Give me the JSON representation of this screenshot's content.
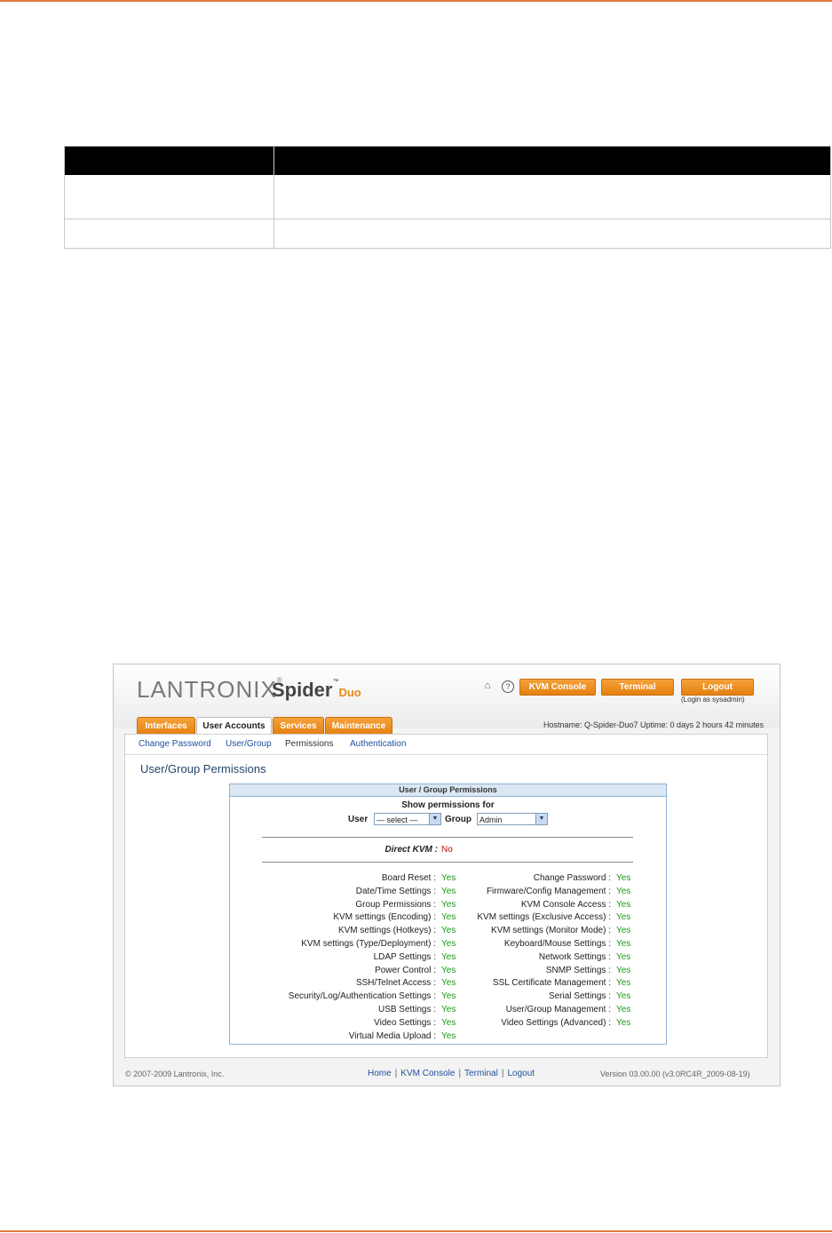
{
  "shot": {
    "brand": "LANTRONIX",
    "product": "Spider",
    "product_suffix": "Duo",
    "buttons": [
      "KVM Console",
      "Terminal",
      "Logout"
    ],
    "login_as": "(Login as sysadmin)",
    "tabs": [
      "Interfaces",
      "User Accounts",
      "Services",
      "Maintenance"
    ],
    "hostinfo": "Hostname: Q-Spider-Duo7    Uptime: 0 days 2 hours 42 minutes",
    "subnav": [
      "Change Password",
      "User/Group",
      "Permissions",
      "Authentication"
    ],
    "page_title": "User/Group Permissions",
    "panel_title": "User / Group Permissions",
    "show_for": "Show permissions for",
    "user_label": "User",
    "user_value": "— select —",
    "group_label": "Group",
    "group_value": "Admin",
    "direct_kvm_label": "Direct KVM :",
    "direct_kvm_value": "No",
    "left_perms": [
      {
        "label": "Board Reset :",
        "value": "Yes"
      },
      {
        "label": "Date/Time Settings :",
        "value": "Yes"
      },
      {
        "label": "Group Permissions :",
        "value": "Yes"
      },
      {
        "label": "KVM settings (Encoding) :",
        "value": "Yes"
      },
      {
        "label": "KVM settings (Hotkeys) :",
        "value": "Yes"
      },
      {
        "label": "KVM settings (Type/Deployment) :",
        "value": "Yes"
      },
      {
        "label": "LDAP Settings :",
        "value": "Yes"
      },
      {
        "label": "Power Control :",
        "value": "Yes"
      },
      {
        "label": "SSH/Telnet Access :",
        "value": "Yes"
      },
      {
        "label": "Security/Log/Authentication Settings :",
        "value": "Yes"
      },
      {
        "label": "USB Settings :",
        "value": "Yes"
      },
      {
        "label": "Video Settings :",
        "value": "Yes"
      },
      {
        "label": "Virtual Media Upload :",
        "value": "Yes"
      }
    ],
    "right_perms": [
      {
        "label": "Change Password :",
        "value": "Yes"
      },
      {
        "label": "Firmware/Config Management :",
        "value": "Yes"
      },
      {
        "label": "KVM Console Access :",
        "value": "Yes"
      },
      {
        "label": "KVM settings (Exclusive Access) :",
        "value": "Yes"
      },
      {
        "label": "KVM settings (Monitor Mode) :",
        "value": "Yes"
      },
      {
        "label": "Keyboard/Mouse Settings :",
        "value": "Yes"
      },
      {
        "label": "Network Settings :",
        "value": "Yes"
      },
      {
        "label": "SNMP Settings :",
        "value": "Yes"
      },
      {
        "label": "SSL Certificate Management :",
        "value": "Yes"
      },
      {
        "label": "Serial Settings :",
        "value": "Yes"
      },
      {
        "label": "User/Group Management :",
        "value": "Yes"
      },
      {
        "label": "Video Settings (Advanced) :",
        "value": "Yes"
      }
    ],
    "footer_copy": "© 2007-2009 Lantronix, Inc.",
    "footer_links": [
      "Home",
      "KVM Console",
      "Terminal",
      "Logout"
    ],
    "footer_version": "Version 03.00.00 (v3.0RC4R_2009-08-19)"
  }
}
